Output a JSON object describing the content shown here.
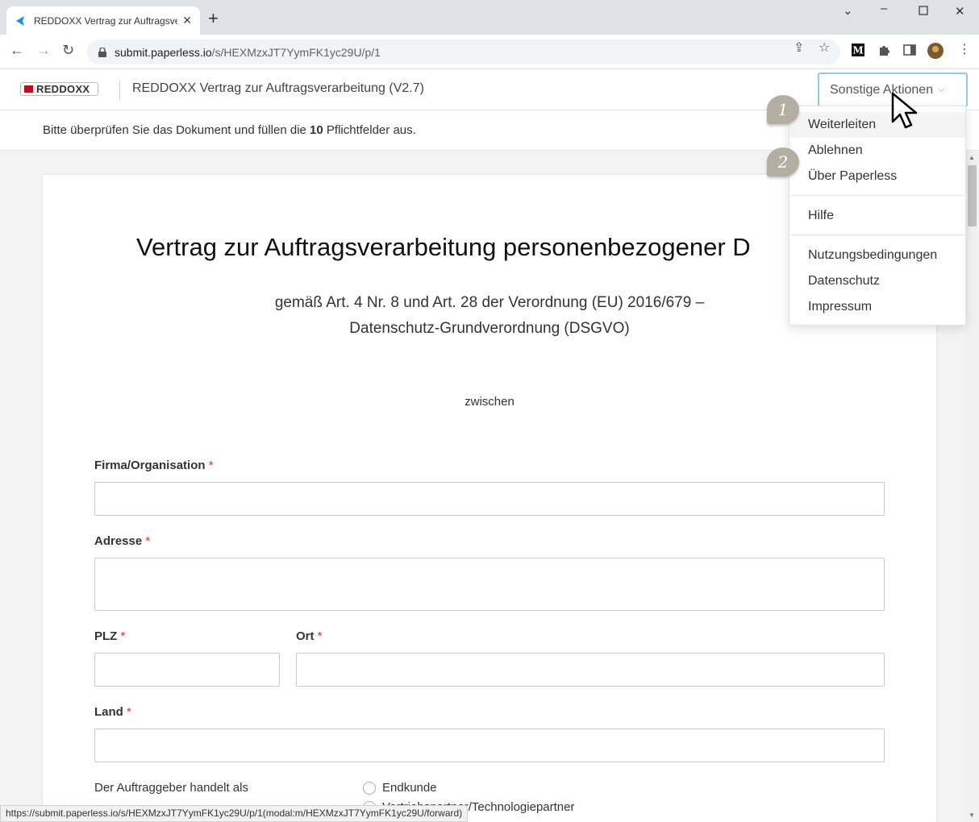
{
  "browser": {
    "tab_title": "REDDOXX Vertrag zur Auftragsve",
    "url_host": "submit.paperless.io",
    "url_path": "/s/HEXMzxJT7YymFK1yc29U/p/1",
    "status_url": "https://submit.paperless.io/s/HEXMzxJT7YymFK1yc29U/p/1(modal:m/HEXMzxJT7YymFK1yc29U/forward)"
  },
  "header": {
    "logo_text": "REDDOXX",
    "title": "REDDOXX Vertrag zur Auftragsverarbeitung (V2.7)",
    "actions_label": "Sonstige Aktionen"
  },
  "notice": {
    "prefix": "Bitte überprüfen Sie das Dokument und füllen die ",
    "count": "10",
    "suffix": " Pflichtfelder aus."
  },
  "document": {
    "title": "Vertrag zur Auftragsverarbeitung personenbezogener D",
    "subtitle_line1": "gemäß Art. 4 Nr. 8 und Art. 28 der Verordnung (EU) 2016/679 –",
    "subtitle_line2": "Datenschutz-Grundverordnung (DSGVO)",
    "between": "zwischen",
    "required_mark": "*",
    "fields": {
      "company": "Firma/Organisation",
      "address": "Adresse",
      "zip": "PLZ",
      "city": "Ort",
      "country": "Land"
    },
    "client_acts_as": "Der Auftraggeber handelt als",
    "radio_options": [
      "Endkunde",
      "Vertriebspartner/Technologiepartner"
    ]
  },
  "menu": {
    "items": [
      "Weiterleiten",
      "Ablehnen",
      "Über Paperless",
      "Hilfe",
      "Nutzungsbedingungen",
      "Datenschutz",
      "Impressum"
    ]
  },
  "annotations": [
    "1",
    "2"
  ],
  "colors": {
    "required": "#d33333",
    "brand": "#b5121b",
    "focus_border": "#99c7ec",
    "badge": "#b3ada2"
  }
}
